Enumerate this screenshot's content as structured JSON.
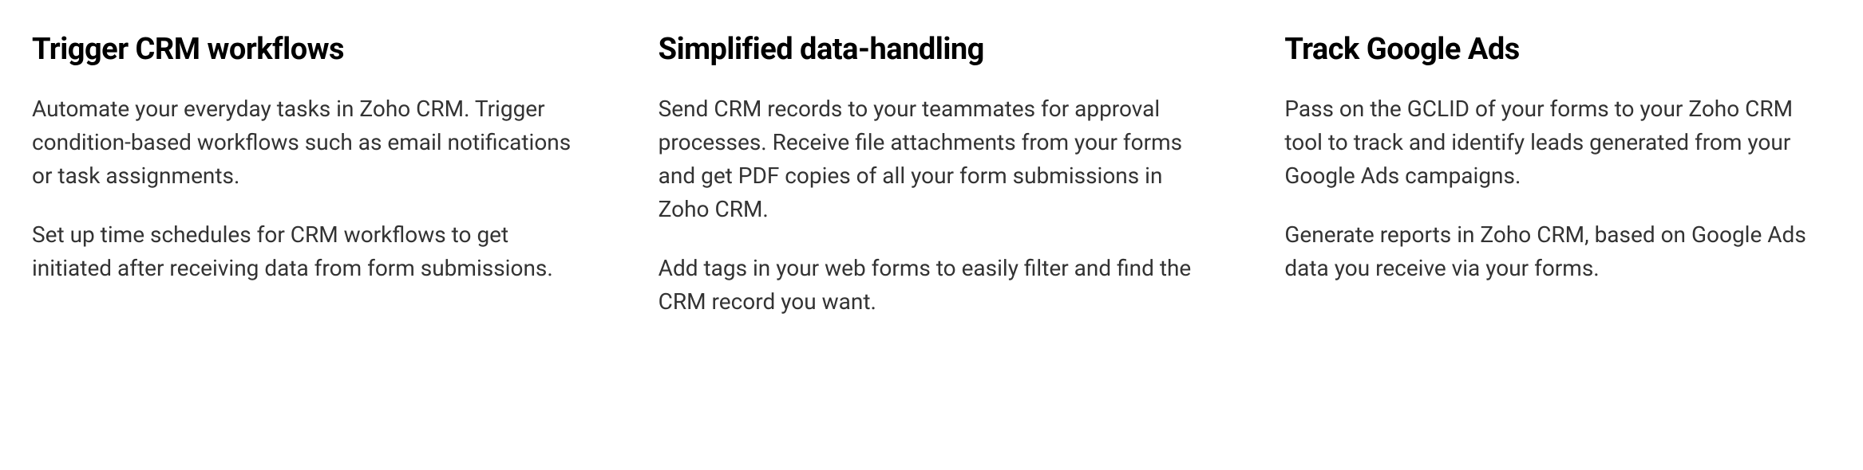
{
  "features": [
    {
      "heading": "Trigger CRM workflows",
      "paragraphs": [
        "Automate your everyday tasks in Zoho CRM. Trigger condition-based workflows such as email notifications or task assignments.",
        "Set up time schedules for CRM workflows to get initiated after receiving data from form submissions."
      ]
    },
    {
      "heading": "Simplified data-handling",
      "paragraphs": [
        "Send CRM records to your teammates for approval processes. Receive file attachments from your forms and get PDF copies of all your form submissions in Zoho CRM.",
        "Add tags in your web forms to easily filter and find the CRM record you want."
      ]
    },
    {
      "heading": "Track Google Ads",
      "paragraphs": [
        "Pass on the GCLID of your forms to your Zoho CRM tool to track and identify leads generated from your Google Ads campaigns.",
        "Generate reports in Zoho CRM, based on Google Ads data you receive via your forms."
      ]
    }
  ]
}
